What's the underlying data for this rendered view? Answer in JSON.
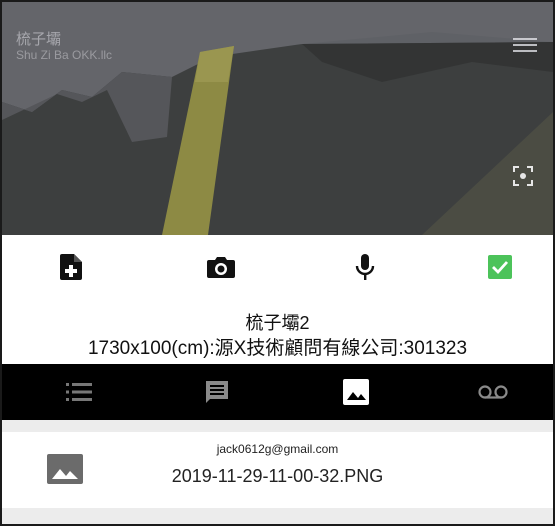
{
  "header": {
    "brand_title": "梳子壩",
    "brand_subtitle": "Shu Zi Ba  OKK.llc"
  },
  "toolbar": {
    "items": [
      {
        "name": "add-file",
        "icon": "add-file-icon"
      },
      {
        "name": "camera",
        "icon": "camera-icon"
      },
      {
        "name": "microphone",
        "icon": "microphone-icon"
      },
      {
        "name": "confirm",
        "icon": "checkbox-checked-icon",
        "color": "#4cc35a"
      }
    ]
  },
  "info": {
    "name": "梳子壩2",
    "detail": "1730x100(cm):源X技術顧問有線公司:301323"
  },
  "tabs": [
    {
      "name": "list",
      "icon": "list-icon",
      "active": false
    },
    {
      "name": "comments",
      "icon": "comment-icon",
      "active": false
    },
    {
      "name": "images",
      "icon": "image-icon",
      "active": true
    },
    {
      "name": "voicemail",
      "icon": "voicemail-icon",
      "active": false
    }
  ],
  "list": {
    "items": [
      {
        "email": "jack0612g@gmail.com",
        "filename": "2019-11-29-11-00-32.PNG",
        "icon": "image-icon"
      }
    ]
  },
  "colors": {
    "tabbar_bg": "#000000",
    "accent_green": "#4cc35a",
    "terrain_dark": "#3a3c3c",
    "terrain_yellow": "#8d8a44"
  }
}
